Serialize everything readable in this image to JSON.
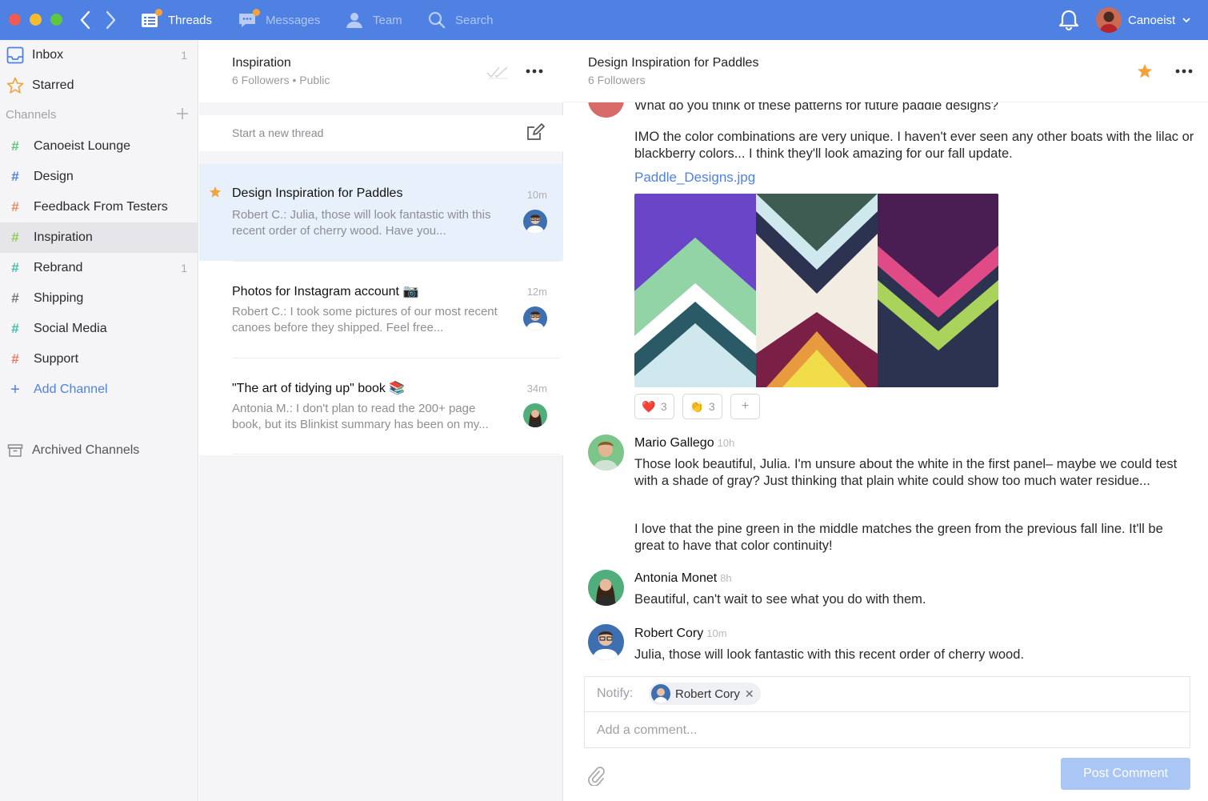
{
  "topbar": {
    "nav": [
      {
        "label": "Threads",
        "icon": "threads-icon"
      },
      {
        "label": "Messages",
        "icon": "messages-icon"
      },
      {
        "label": "Team",
        "icon": "team-icon"
      },
      {
        "label": "Search",
        "icon": "search-icon"
      }
    ],
    "user_name": "Canoeist",
    "colors": {
      "bar": "#4f81e2",
      "badge": "#f2a33a"
    }
  },
  "sidebar": {
    "inbox": {
      "label": "Inbox",
      "count": "1"
    },
    "starred": {
      "label": "Starred"
    },
    "channels_label": "Channels",
    "channels": [
      {
        "label": "Canoeist Lounge",
        "color": "#5fc77b",
        "count": ""
      },
      {
        "label": "Design",
        "color": "#4f81e2",
        "count": ""
      },
      {
        "label": "Feedback From Testers",
        "color": "#f08a5d",
        "count": ""
      },
      {
        "label": "Inspiration",
        "color": "#8ccf5b",
        "count": ""
      },
      {
        "label": "Rebrand",
        "color": "#3ec3a7",
        "count": "1"
      },
      {
        "label": "Shipping",
        "color": "#777777",
        "count": ""
      },
      {
        "label": "Social Media",
        "color": "#3ec3a7",
        "count": ""
      },
      {
        "label": "Support",
        "color": "#f07a5d",
        "count": ""
      }
    ],
    "add_channel": "Add Channel",
    "archived": "Archived Channels"
  },
  "threads": {
    "title": "Inspiration",
    "subtitle": "6 Followers • Public",
    "new_thread_placeholder": "Start a new thread",
    "items": [
      {
        "title": "Design Inspiration for Paddles",
        "time": "10m",
        "preview": "Robert C.: Julia, those will look fantastic with this recent order of cherry wood. Have you...",
        "starred": true
      },
      {
        "title": "Photos for Instagram account 📷",
        "time": "12m",
        "preview": "Robert C.: I took some pictures of our most recent canoes before they shipped. Feel free...",
        "starred": false
      },
      {
        "title": "\"The art of tidying up\" book 📚",
        "time": "34m",
        "preview": "Antonia M.: I don't plan to read the 200+ page book, but its Blinkist summary has been on my...",
        "starred": false
      }
    ]
  },
  "conversation": {
    "title": "Design Inspiration for Paddles",
    "subtitle": "6 Followers",
    "first_message": {
      "line0": "What do you think of these patterns for future paddle designs?",
      "para": "IMO the color combinations are very unique. I haven't ever seen any other boats with the lilac or blackberry colors... I think they'll look amazing for our fall update.",
      "attachment": "Paddle_Designs.jpg",
      "reactions": [
        {
          "emoji": "❤️",
          "count": "3"
        },
        {
          "emoji": "👏",
          "count": "3"
        },
        {
          "emoji": "+",
          "count": ""
        }
      ]
    },
    "messages": [
      {
        "author": "Mario Gallego",
        "time": "10h",
        "text1": "Those look beautiful, Julia. I'm unsure about the white in the first panel– maybe we could test with a shade of gray? Just thinking that plain white could show too much water residue...",
        "text2": "I love that the pine green in the middle matches the green from the previous fall line. It'll be great to have that color continuity!"
      },
      {
        "author": "Antonia Monet",
        "time": "8h",
        "text1": "Beautiful, can't wait to see what you do with them."
      },
      {
        "author": "Robert Cory",
        "time": "10m",
        "text1": "Julia, those will look fantastic with this recent order of cherry wood."
      }
    ],
    "notify_label": "Notify:",
    "notify_chip": "Robert Cory",
    "comment_placeholder": "Add a comment...",
    "post_label": "Post Comment"
  }
}
